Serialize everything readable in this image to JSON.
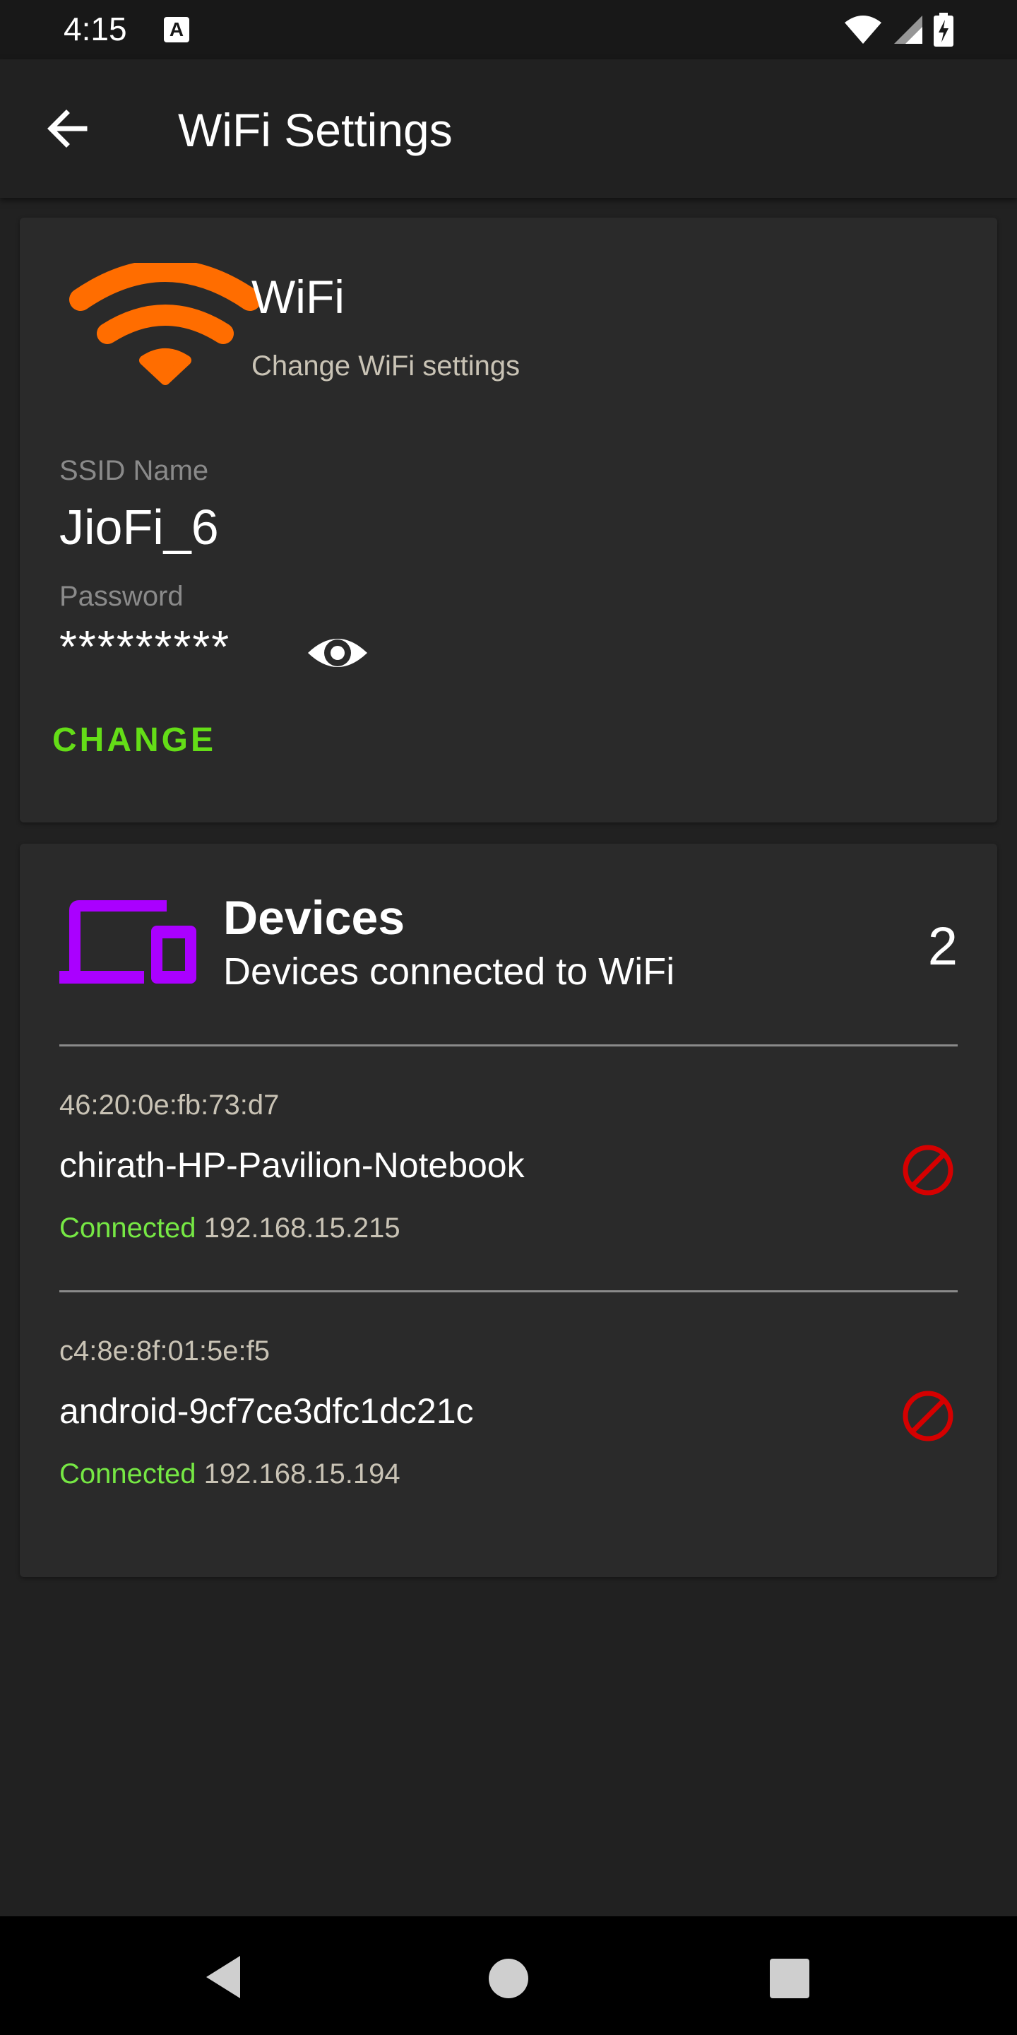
{
  "status_bar": {
    "time": "4:15",
    "notification_icon": "A",
    "icons": [
      "wifi-icon",
      "signal-icon",
      "battery-charging-icon"
    ]
  },
  "app_bar": {
    "title": "WiFi Settings",
    "back_icon": "arrow-left-icon"
  },
  "wifi_card": {
    "title": "WiFi",
    "subtitle": "Change WiFi settings",
    "icon": "wifi-icon",
    "icon_color": "#ff6d00",
    "ssid_label": "SSID Name",
    "ssid_value": "JioFi_6",
    "password_label": "Password",
    "password_value": "*********",
    "toggle_icon": "eye-icon",
    "change_label": "CHANGE",
    "accent_color": "#64dd17"
  },
  "devices_card": {
    "title": "Devices",
    "subtitle": "Devices connected to WiFi",
    "count": "2",
    "icon": "devices-icon",
    "icon_color": "#aa00ff",
    "devices": [
      {
        "mac": "46:20:0e:fb:73:d7",
        "name": "chirath-HP-Pavilion-Notebook",
        "status": "Connected",
        "ip": "192.168.15.215"
      },
      {
        "mac": "c4:8e:8f:01:5e:f5",
        "name": "android-9cf7ce3dfc1dc21c",
        "status": "Connected",
        "ip": "192.168.15.194"
      }
    ],
    "block_icon": "block-icon",
    "block_color": "#d50000"
  },
  "nav_bar": {
    "icons": [
      "nav-back-icon",
      "nav-home-icon",
      "nav-recents-icon"
    ]
  }
}
